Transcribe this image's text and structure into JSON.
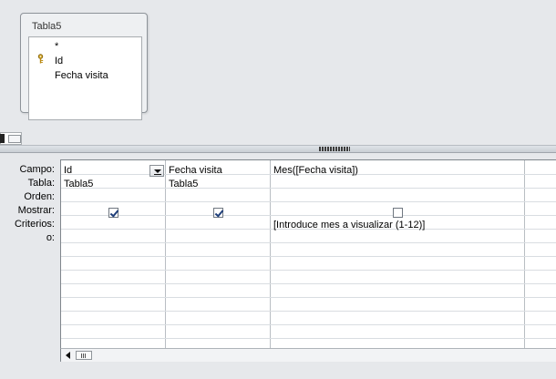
{
  "table_box": {
    "title": "Tabla5",
    "fields": [
      "*",
      "Id",
      "Fecha visita"
    ]
  },
  "row_labels": [
    "Campo:",
    "Tabla:",
    "Orden:",
    "Mostrar:",
    "Criterios:",
    "o:"
  ],
  "columns": [
    {
      "campo": "Id",
      "tabla": "Tabla5",
      "mostrar": true,
      "criterios": ""
    },
    {
      "campo": "Fecha visita",
      "tabla": "Tabla5",
      "mostrar": true,
      "criterios": ""
    },
    {
      "campo": "Mes([Fecha visita])",
      "tabla": "",
      "mostrar": false,
      "criterios": "[Introduce mes a visualizar (1-12)]"
    }
  ]
}
